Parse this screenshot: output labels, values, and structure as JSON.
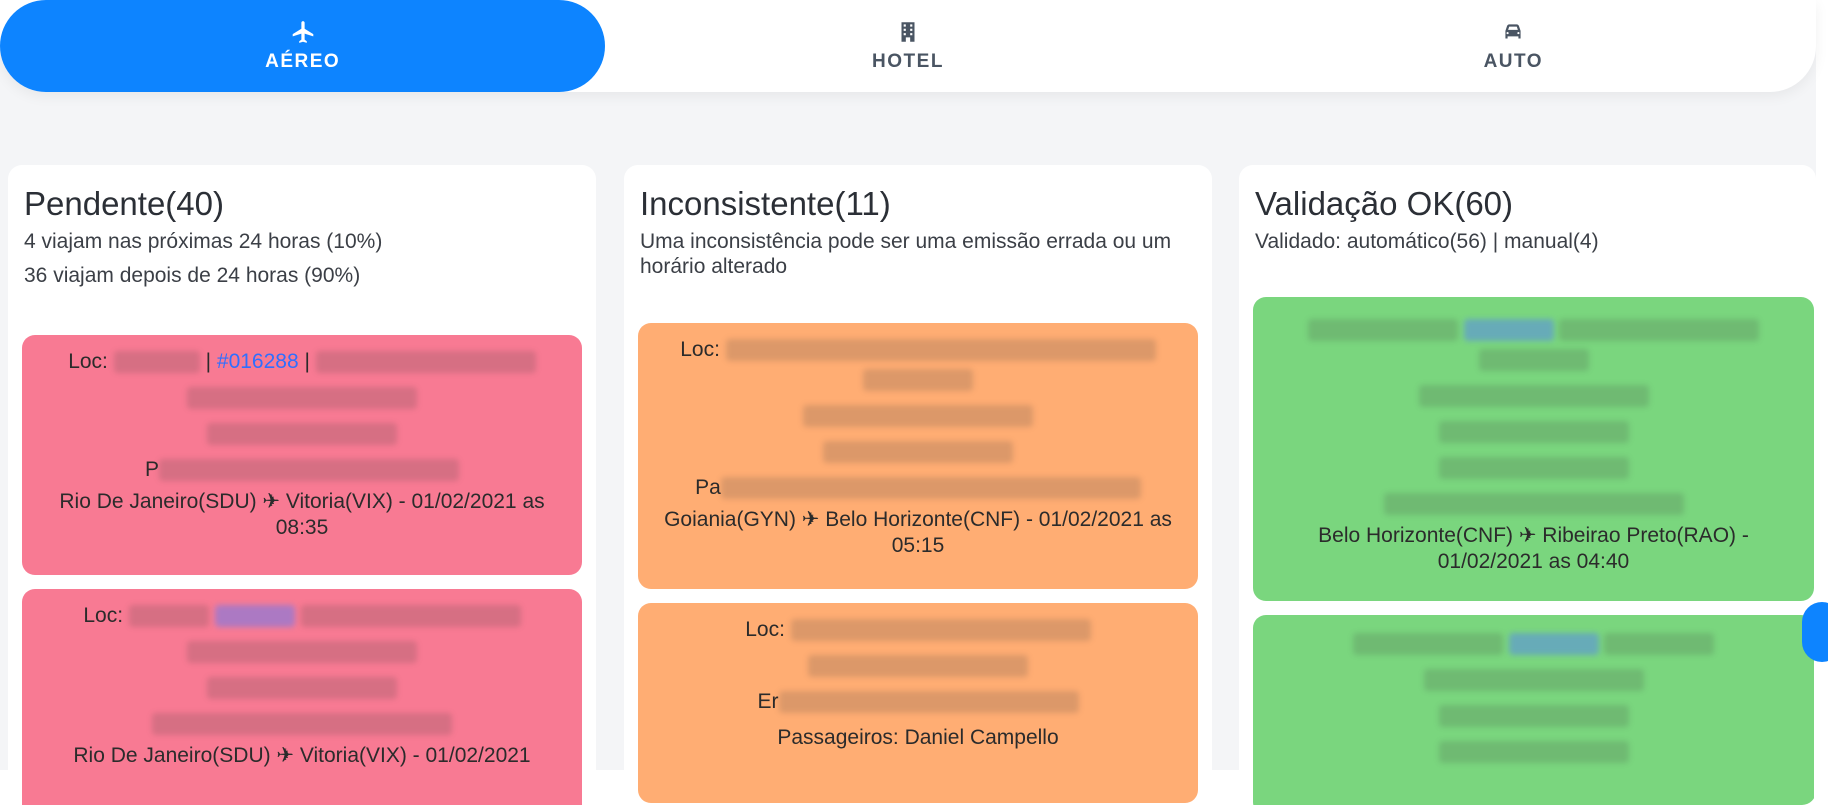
{
  "tabs": [
    {
      "label": "AÉREO",
      "icon": "plane-icon",
      "active": true
    },
    {
      "label": "HOTEL",
      "icon": "hotel-icon",
      "active": false
    },
    {
      "label": "AUTO",
      "icon": "car-icon",
      "active": false
    }
  ],
  "columns": {
    "pendente": {
      "title": "Pendente(40)",
      "sub1": "4 viajam nas próximas 24 horas (10%)",
      "sub2": "36 viajam depois de 24 horas (90%)",
      "color": "#f87a93",
      "cards": [
        {
          "loc_label": "Loc:",
          "loc_number": "#016288",
          "separator": "|",
          "passenger_prefix": "P",
          "route": "Rio De Janeiro(SDU) ✈ Vitoria(VIX) - 01/02/2021 as 08:35"
        },
        {
          "loc_label": "Loc:",
          "route": "Rio De Janeiro(SDU) ✈ Vitoria(VIX) - 01/02/2021"
        }
      ]
    },
    "inconsistente": {
      "title": "Inconsistente(11)",
      "sub1": "Uma inconsistência pode ser uma emissão errada ou um horário alterado",
      "color": "#ffad73",
      "cards": [
        {
          "loc_label": "Loc:",
          "passenger_prefix": "Pa",
          "route": "Goiania(GYN) ✈ Belo Horizonte(CNF) - 01/02/2021 as 05:15"
        },
        {
          "loc_label": "Loc:",
          "emitter_prefix": "Er",
          "passengers": "Passageiros: Daniel Campello"
        }
      ]
    },
    "validacao": {
      "title": "Validação OK(60)",
      "sub1": "Validado: automático(56) | manual(4)",
      "color": "#7ad67e",
      "cards": [
        {
          "route": "Belo Horizonte(CNF) ✈ Ribeirao Preto(RAO) - 01/02/2021 as 04:40"
        },
        {}
      ]
    }
  },
  "accent_color": "#0d84ff"
}
